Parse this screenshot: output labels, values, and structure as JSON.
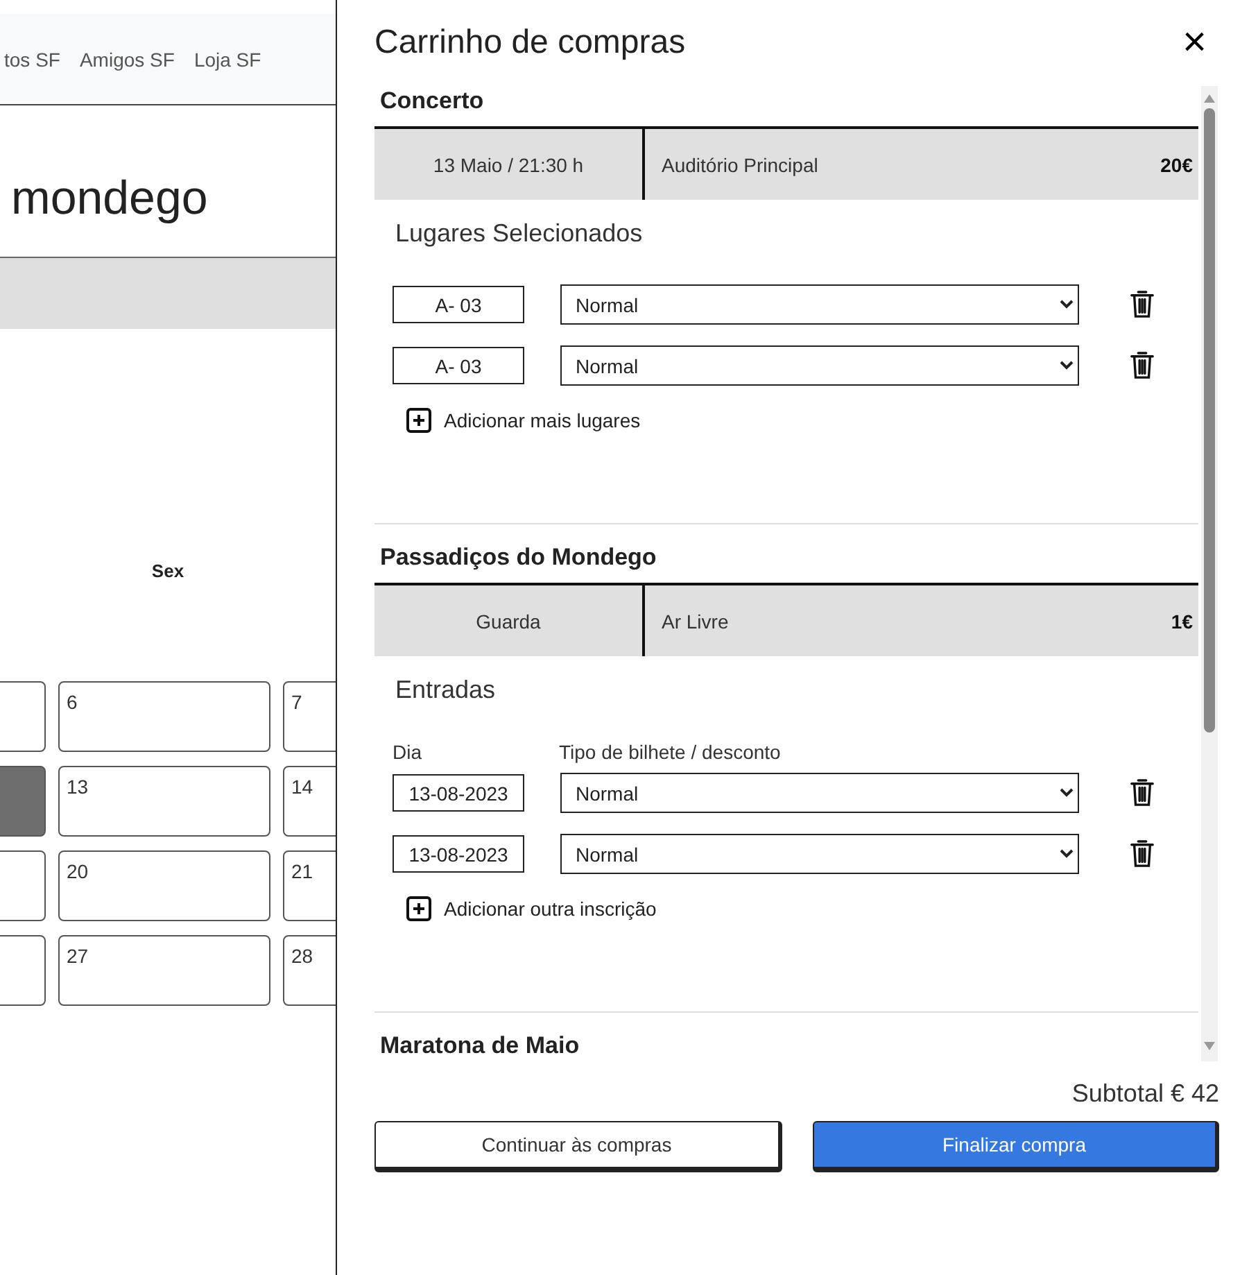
{
  "background_page": {
    "nav_links": [
      "tos SF",
      "Amigos SF",
      "Loja SF"
    ],
    "title": "mondego",
    "weekday": "Sex",
    "calendar_weeks": [
      {
        "cells": [
          {
            "selected": false
          },
          {
            "day": "6",
            "selected": false
          },
          {
            "day": "7",
            "selected": false
          }
        ]
      },
      {
        "cells": [
          {
            "selected": true
          },
          {
            "day": "13",
            "selected": false
          },
          {
            "day": "14",
            "selected": false
          }
        ]
      },
      {
        "cells": [
          {
            "selected": false
          },
          {
            "day": "20",
            "selected": false
          },
          {
            "day": "21",
            "selected": false
          }
        ]
      },
      {
        "cells": [
          {
            "selected": false
          },
          {
            "day": "27",
            "selected": false
          },
          {
            "day": "28",
            "selected": false
          }
        ]
      }
    ]
  },
  "cart": {
    "title": "Carrinho de compras",
    "close": "×",
    "sections": [
      {
        "title": "Concerto",
        "when_where": "13 Maio / 21:30 h",
        "venue": "Auditório Principal",
        "price": "20€",
        "subheading": "Lugares Selecionados",
        "rows": [
          {
            "code": "A- 03",
            "ticket": "Normal"
          },
          {
            "code": "A- 03",
            "ticket": "Normal"
          }
        ],
        "add_label": "Adicionar mais lugares"
      },
      {
        "title": "Passadiços do Mondego",
        "when_where": "Guarda",
        "venue": "Ar Livre",
        "price": "1€",
        "subheading": "Entradas",
        "column_labels": [
          "Dia",
          "Tipo de bilhete / desconto"
        ],
        "rows": [
          {
            "code": "13-08-2023",
            "ticket": "Normal"
          },
          {
            "code": "13-08-2023",
            "ticket": "Normal"
          }
        ],
        "add_label": "Adicionar outra inscrição"
      },
      {
        "title": "Maratona de Maio"
      }
    ],
    "subtotal": "Subtotal € 42",
    "buttons": [
      "Continuar às compras",
      "Finalizar compra"
    ]
  }
}
